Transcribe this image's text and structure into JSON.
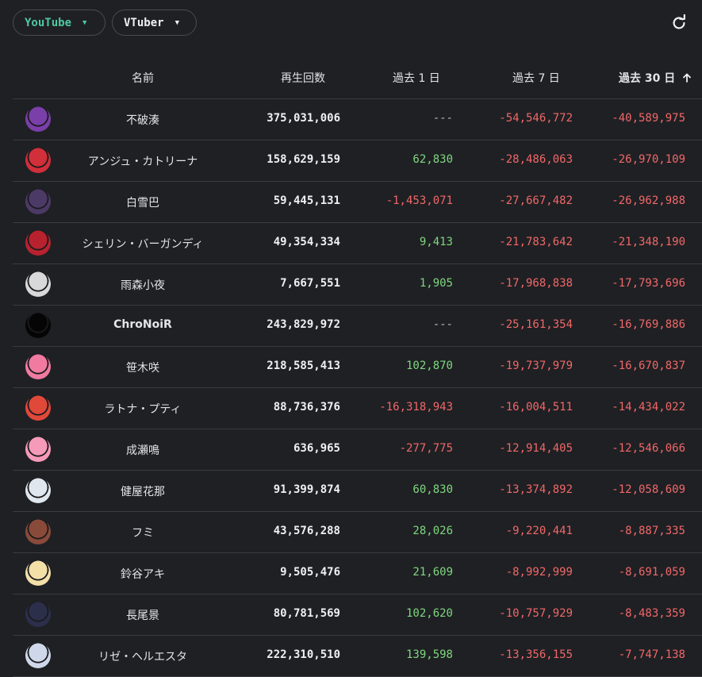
{
  "filters": {
    "platform": {
      "label": "YouTube",
      "color": "#4ec9a0"
    },
    "category": {
      "label": "VTuber"
    }
  },
  "refresh_icon": "refresh-icon",
  "columns": {
    "name": "名前",
    "views": "再生回数",
    "d1": "過去 1 日",
    "d7": "過去 7 日",
    "d30": "過去 30 日",
    "sort_icon": "arrow-up-icon"
  },
  "colors": {
    "positive": "#7ed87e",
    "negative": "#f06868"
  },
  "rows": [
    {
      "name": "不破湊",
      "views": "375,031,006",
      "d1": "---",
      "d7": "-54,546,772",
      "d30": "-40,589,975",
      "avatar": "#7a3fa8"
    },
    {
      "name": "アンジュ・カトリーナ",
      "views": "158,629,159",
      "d1": "62,830",
      "d7": "-28,486,063",
      "d30": "-26,970,109",
      "avatar": "#d12f3a"
    },
    {
      "name": "白雪巴",
      "views": "59,445,131",
      "d1": "-1,453,071",
      "d7": "-27,667,482",
      "d30": "-26,962,988",
      "avatar": "#4b3a66"
    },
    {
      "name": "シェリン・バーガンディ",
      "views": "49,354,334",
      "d1": "9,413",
      "d7": "-21,783,642",
      "d30": "-21,348,190",
      "avatar": "#b8222e"
    },
    {
      "name": "雨森小夜",
      "views": "7,667,551",
      "d1": "1,905",
      "d7": "-17,968,838",
      "d30": "-17,793,696",
      "avatar": "#d8d8da"
    },
    {
      "name": "ChroNoiR",
      "views": "243,829,972",
      "d1": "---",
      "d7": "-25,161,354",
      "d30": "-16,769,886",
      "avatar": "#050505"
    },
    {
      "name": "笹木咲",
      "views": "218,585,413",
      "d1": "102,870",
      "d7": "-19,737,979",
      "d30": "-16,670,837",
      "avatar": "#f07aa0"
    },
    {
      "name": "ラトナ・プティ",
      "views": "88,736,376",
      "d1": "-16,318,943",
      "d7": "-16,004,511",
      "d30": "-14,434,022",
      "avatar": "#e0483a"
    },
    {
      "name": "成瀬鳴",
      "views": "636,965",
      "d1": "-277,775",
      "d7": "-12,914,405",
      "d30": "-12,546,066",
      "avatar": "#f59ab8"
    },
    {
      "name": "健屋花那",
      "views": "91,399,874",
      "d1": "60,830",
      "d7": "-13,374,892",
      "d30": "-12,058,609",
      "avatar": "#dfe6ee"
    },
    {
      "name": "フミ",
      "views": "43,576,288",
      "d1": "28,026",
      "d7": "-9,220,441",
      "d30": "-8,887,335",
      "avatar": "#8a4a3a"
    },
    {
      "name": "鈴谷アキ",
      "views": "9,505,476",
      "d1": "21,609",
      "d7": "-8,992,999",
      "d30": "-8,691,059",
      "avatar": "#f3dfa8"
    },
    {
      "name": "長尾景",
      "views": "80,781,569",
      "d1": "102,620",
      "d7": "-10,757,929",
      "d30": "-8,483,359",
      "avatar": "#2b2f4a"
    },
    {
      "name": "リゼ・ヘルエスタ",
      "views": "222,310,510",
      "d1": "139,598",
      "d7": "-13,356,155",
      "d30": "-7,747,138",
      "avatar": "#cfd8ea"
    }
  ]
}
